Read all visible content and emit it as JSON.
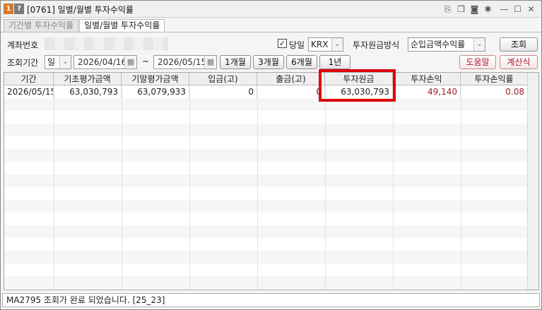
{
  "window": {
    "badge_one": "1",
    "badge_help": "?",
    "title": "[0761] 일별/월별 투자수익률"
  },
  "tabs": [
    {
      "label": "기간별 투자수익률"
    },
    {
      "label": "일별/월별 투자수익률"
    }
  ],
  "form": {
    "account_label": "계좌번호",
    "same_day_checked": "✓",
    "same_day_label": "당일",
    "exchange_value": "KRX",
    "principal_method_label": "투자원금방식",
    "principal_method_value": "순입금액수익률",
    "query_button": "조회",
    "period_label": "조회기간",
    "period_unit_value": "일",
    "start_date": "2026/04/16",
    "tilde": "~",
    "end_date": "2026/05/15",
    "quick_1m": "1개월",
    "quick_3m": "3개월",
    "quick_6m": "6개월",
    "quick_1y": "1년",
    "help_button": "도움말",
    "calc_button": "계산식"
  },
  "table": {
    "headers": [
      "기간",
      "기초평가금액",
      "기말평가금액",
      "입금(고)",
      "출금(고)",
      "투자원금",
      "투자손익",
      "투자손익률"
    ],
    "rows": [
      [
        "2026/05/15",
        "63,030,793",
        "63,079,933",
        "0",
        "0",
        "63,030,793",
        "49,140",
        "0.08"
      ]
    ]
  },
  "status": {
    "message": "MA2795 조회가 완료 되었습니다. [25_23]"
  },
  "colors": {
    "highlight": "#e0000b",
    "profit_text": "#a0202a"
  }
}
